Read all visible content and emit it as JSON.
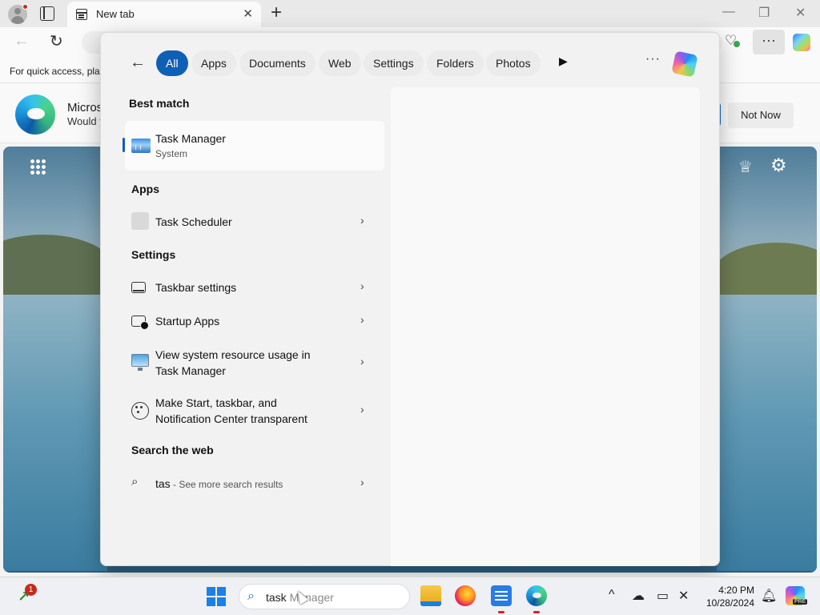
{
  "browser": {
    "tab_title": "New tab",
    "tab_close": "✕",
    "new_tab": "+",
    "window_controls": {
      "minimize": "—",
      "restore": "❐",
      "close": "✕"
    },
    "back": "←",
    "refresh": "↻",
    "more": "···",
    "favorites_hint": "For quick access, pla",
    "banner": {
      "title": "Micros",
      "subtitle": "Would y",
      "not_now": "Not Now"
    }
  },
  "search_panel": {
    "back": "←",
    "filters": [
      "All",
      "Apps",
      "Documents",
      "Web",
      "Settings",
      "Folders",
      "Photos"
    ],
    "active_filter": "All",
    "play": "▶",
    "more": "···",
    "best_match_heading": "Best match",
    "best_match": {
      "title": "Task Manager",
      "subtitle": "System"
    },
    "apps_heading": "Apps",
    "apps": [
      {
        "label": "Task Scheduler"
      }
    ],
    "settings_heading": "Settings",
    "settings": [
      {
        "line1": "Taskbar settings",
        "line2": ""
      },
      {
        "line1": "Startup Apps",
        "line2": ""
      },
      {
        "line1": "View system resource usage in",
        "line2": "Task Manager"
      },
      {
        "line1": "Make Start, taskbar, and",
        "line2": "Notification Center transparent"
      }
    ],
    "web_heading": "Search the web",
    "web_result": {
      "query": "tas",
      "hint": " - See more search results"
    },
    "chevron": "›"
  },
  "taskbar": {
    "badge_count": "1",
    "search_typed": "task",
    "search_ghost": " Manager",
    "time": "4:20 PM",
    "date": "10/28/2024",
    "copilot_badge": "PRE",
    "tray_chevron": "^"
  }
}
